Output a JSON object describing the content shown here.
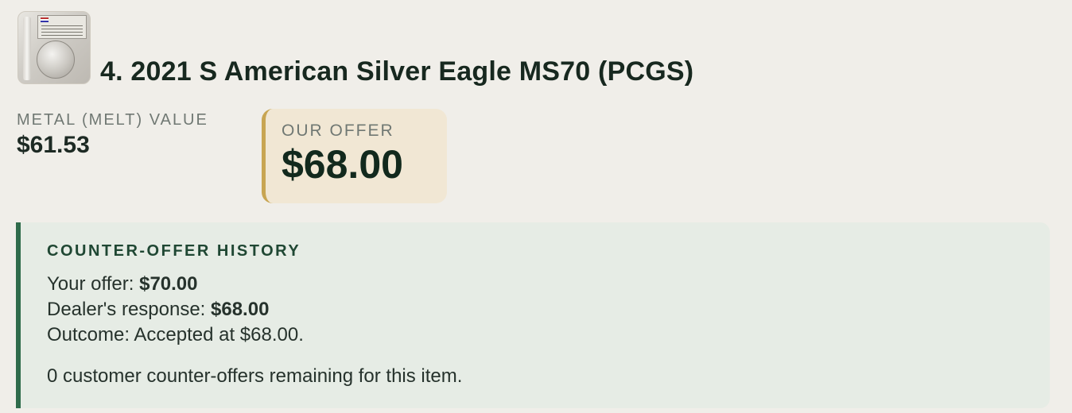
{
  "item": {
    "title": "4. 2021 S American Silver Eagle MS70 (PCGS)",
    "thumbnail": "coin-slab-image"
  },
  "melt": {
    "label": "METAL (MELT) VALUE",
    "value": "$61.53"
  },
  "offer": {
    "label": "OUR OFFER",
    "value": "$68.00"
  },
  "history": {
    "heading": "COUNTER-OFFER HISTORY",
    "your_offer_label": "Your offer: ",
    "your_offer_value": "$70.00",
    "dealer_label": "Dealer's response: ",
    "dealer_value": "$68.00",
    "outcome": "Outcome: Accepted at $68.00.",
    "remaining": "0 customer counter-offers remaining for this item."
  },
  "colors": {
    "background": "#f0eee9",
    "offer_bg": "#f1e7d4",
    "offer_accent": "#c8a552",
    "history_bg": "#e6ece5",
    "history_accent": "#2f6b4b"
  }
}
